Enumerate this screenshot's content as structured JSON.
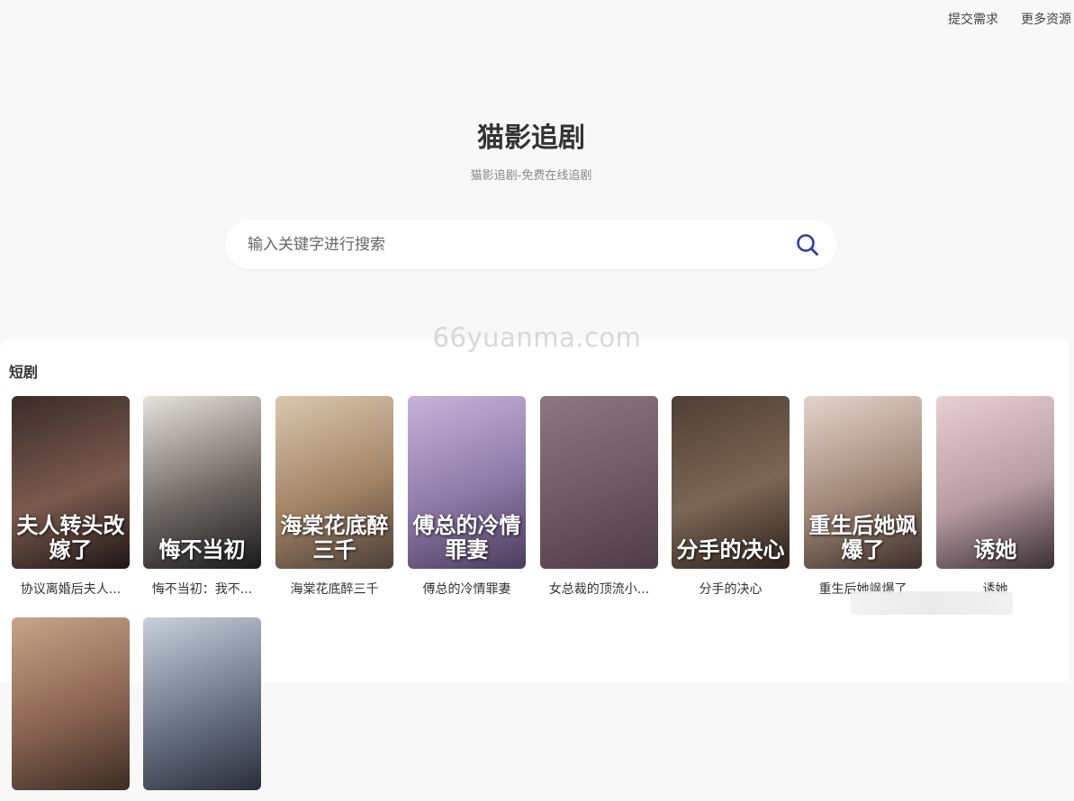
{
  "nav": {
    "submit_request": "提交需求",
    "more_resources": "更多资源"
  },
  "hero": {
    "title": "猫影追剧",
    "subtitle": "猫影追剧-免费在线追剧"
  },
  "search": {
    "placeholder": "输入关键字进行搜索",
    "icon": "search-icon",
    "accent": "#2b3f9c"
  },
  "watermark": "66yuanma.com",
  "section": {
    "title": "短剧",
    "items": [
      {
        "title": "协议离婚后夫人...",
        "poster_text": "夫人转头改嫁了",
        "colors": [
          "#3a2c2a",
          "#7a5a4e",
          "#1e1616"
        ]
      },
      {
        "title": "悔不当初：我不...",
        "poster_text": "悔不当初",
        "colors": [
          "#e6e2dc",
          "#6f6a66",
          "#1a1a1c"
        ]
      },
      {
        "title": "海棠花底醉三千",
        "poster_text": "海棠花底醉三千",
        "colors": [
          "#d8c8b0",
          "#a48466",
          "#4c4038"
        ]
      },
      {
        "title": "傅总的冷情罪妻",
        "poster_text": "傅总的冷情罪妻",
        "colors": [
          "#c8b4d8",
          "#8e7aa8",
          "#4a3c5c"
        ]
      },
      {
        "title": "女总裁的顶流小...",
        "poster_text": "",
        "colors": [
          "#8c7880",
          "#6e5862",
          "#4e3c44"
        ]
      },
      {
        "title": "分手的决心",
        "poster_text": "分手的决心",
        "colors": [
          "#4e3e34",
          "#7a6654",
          "#2c221c"
        ]
      },
      {
        "title": "重生后她飒爆了",
        "poster_text": "重生后她飒爆了",
        "colors": [
          "#e4d4cc",
          "#a08878",
          "#3c2e2a"
        ]
      },
      {
        "title": "诱她",
        "poster_text": "诱她",
        "colors": [
          "#e8cfd2",
          "#b89ca4",
          "#3a3034"
        ]
      },
      {
        "title": "",
        "poster_text": "",
        "colors": [
          "#c8a488",
          "#8a6452",
          "#3c2c24"
        ]
      },
      {
        "title": "",
        "poster_text": "",
        "colors": [
          "#c8d0dc",
          "#6c7486",
          "#2a2e38"
        ]
      }
    ]
  }
}
